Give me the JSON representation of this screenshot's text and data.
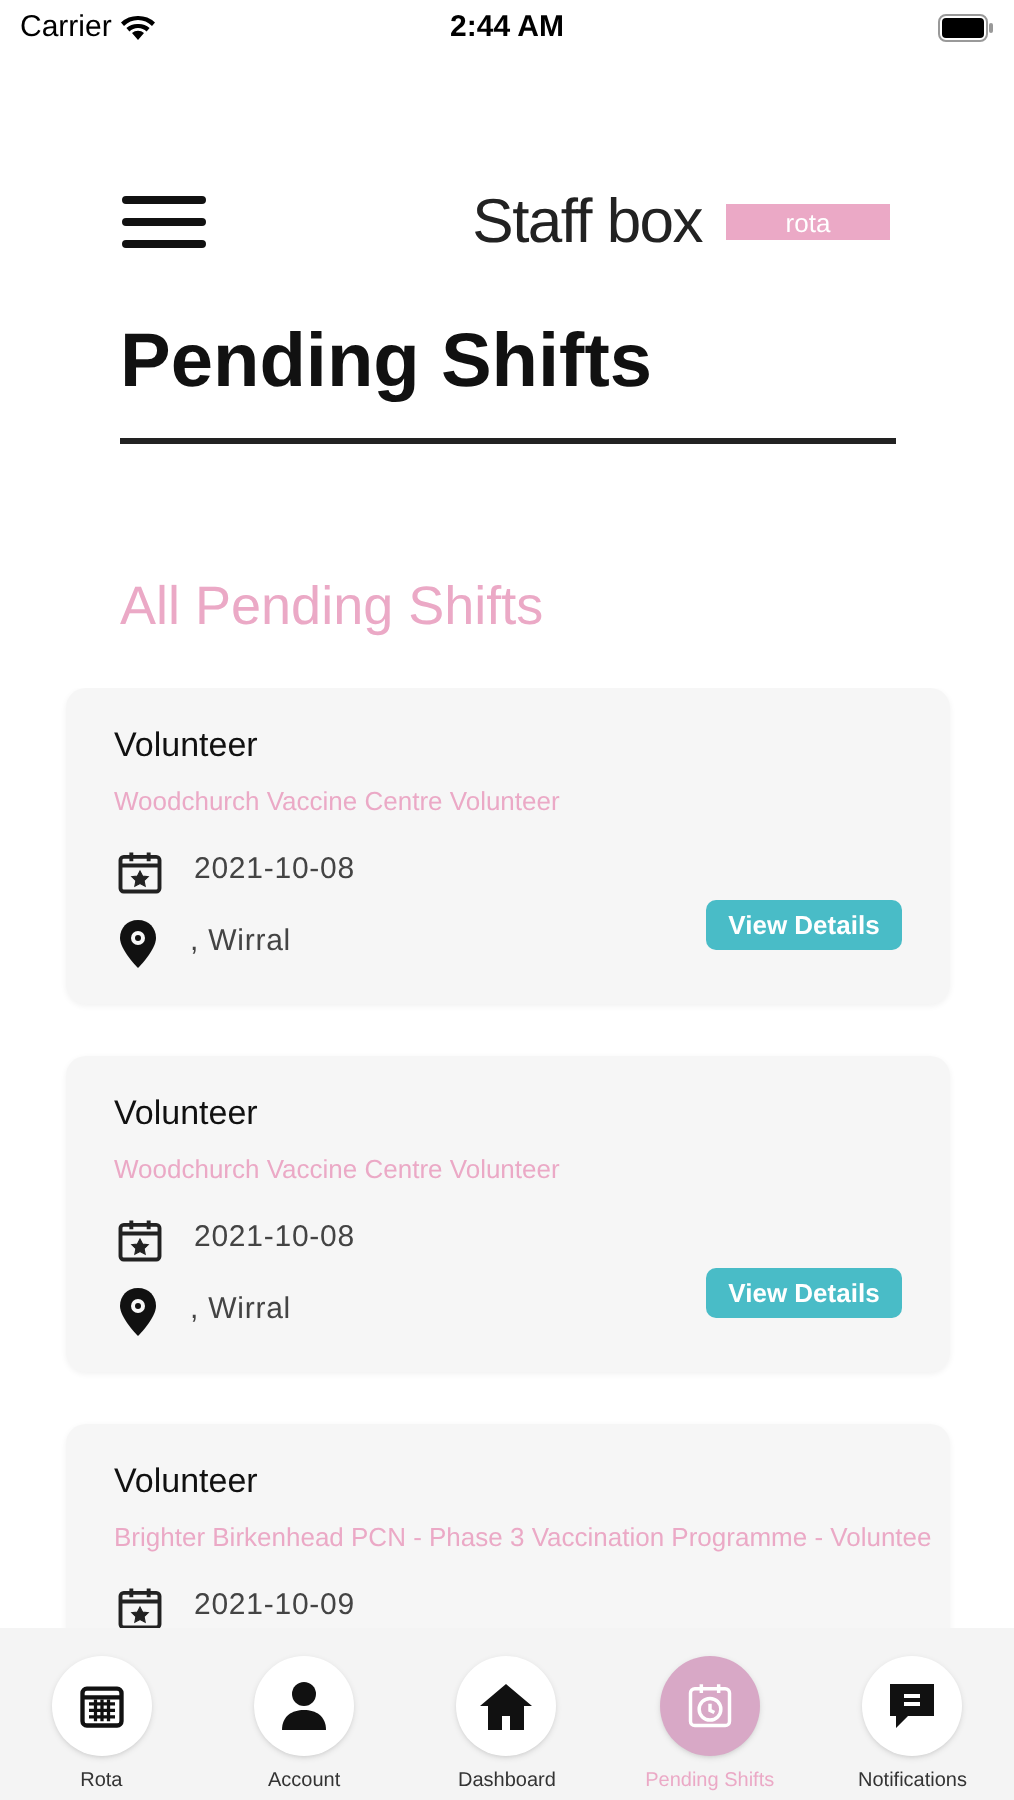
{
  "status_bar": {
    "carrier": "Carrier",
    "time": "2:44 AM"
  },
  "header": {
    "brand": "Staff box",
    "badge": "rota",
    "title": "Pending Shifts"
  },
  "section_title": "All Pending Shifts",
  "shifts": [
    {
      "role": "Volunteer",
      "name": "Woodchurch Vaccine Centre Volunteer",
      "date": "2021-10-08",
      "location": ", Wirral",
      "action": "View Details"
    },
    {
      "role": "Volunteer",
      "name": "Woodchurch Vaccine Centre Volunteer",
      "date": "2021-10-08",
      "location": ", Wirral",
      "action": "View Details"
    },
    {
      "role": "Volunteer",
      "name": "Brighter Birkenhead PCN - Phase 3 Vaccination Programme - Voluntee",
      "date": "2021-10-09"
    }
  ],
  "tab_bar": [
    {
      "label": "Rota",
      "kind": "rota",
      "selected": false
    },
    {
      "label": "Account",
      "kind": "account",
      "selected": false
    },
    {
      "label": "Dashboard",
      "kind": "dashboard",
      "selected": false
    },
    {
      "label": "Pending Shifts",
      "kind": "pending",
      "selected": true
    },
    {
      "label": "Notifications",
      "kind": "notifications",
      "selected": false
    }
  ]
}
